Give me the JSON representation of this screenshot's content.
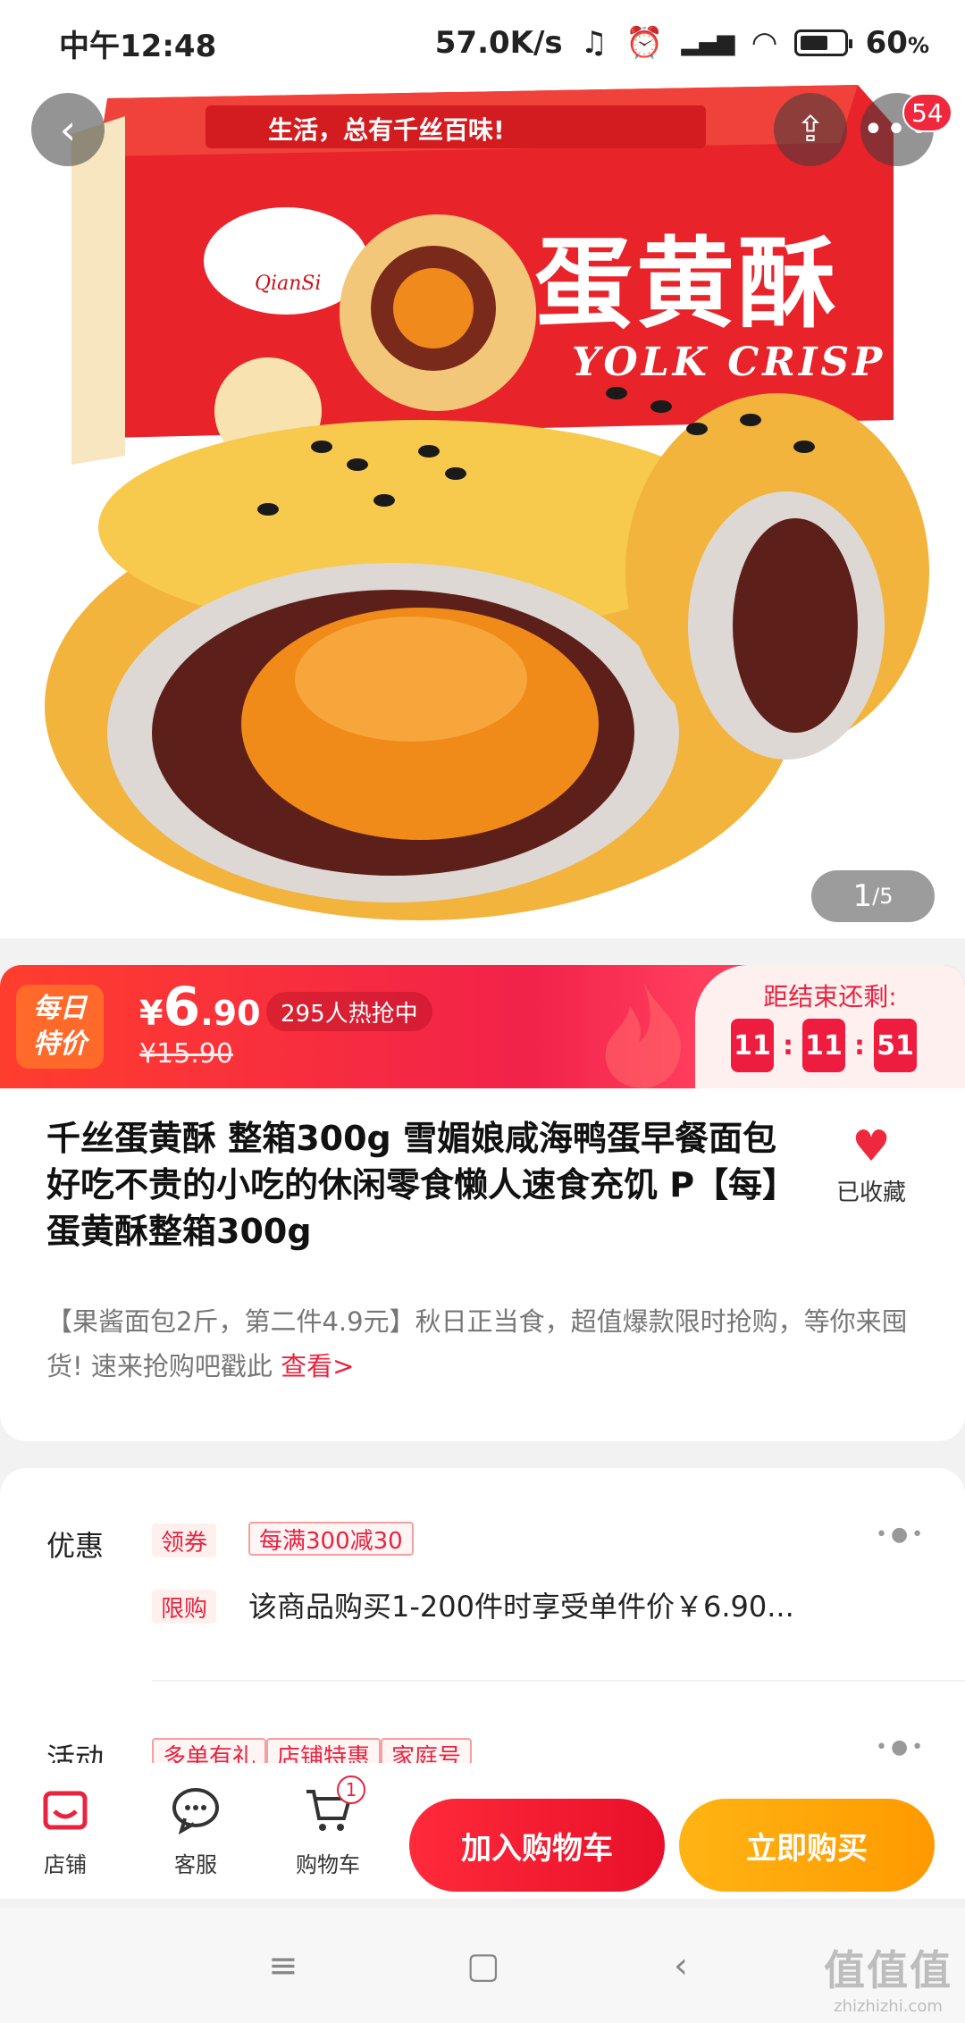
{
  "status_bar": {
    "time": "中午12:48",
    "network_speed": "57.0K/s",
    "battery": "60",
    "battery_unit": "%"
  },
  "header": {
    "cart_badge_count": "54"
  },
  "product_image": {
    "brand_en": "QianSi",
    "box_title": "蛋黄酥",
    "box_subtitle": "YOLK CRISP",
    "box_slogan": "生活，总有千丝百味!",
    "page_current": "1",
    "page_total": "/5"
  },
  "promo": {
    "tag_line1": "每日",
    "tag_line2": "特价",
    "currency": "¥",
    "price_int": "6",
    "price_dec": ".90",
    "price_old": "¥15.90",
    "hot_text": "295人热抢中",
    "countdown_label": "距结束还剩:",
    "countdown": [
      "11",
      "11",
      "51"
    ]
  },
  "product": {
    "title": "千丝蛋黄酥 整箱300g 雪媚娘咸海鸭蛋早餐面包好吃不贵的小吃的休闲零食懒人速食充饥 P【每】蛋黄酥整箱300g",
    "favorite_label": "已收藏",
    "description": "【果酱面包2斤，第二件4.9元】秋日正当食，超值爆款限时抢购，等你来囤货! 速来抢购吧戳此 ",
    "description_link": "查看>"
  },
  "offers": {
    "discount_label": "优惠",
    "coupon_tag": "领券",
    "coupon_value": "每满300减30",
    "limit_tag": "限购",
    "limit_text": "该商品购买1-200件时享受单件价￥6.90...",
    "activity_label": "活动",
    "activity_tags": [
      "多单有礼",
      "店铺特惠",
      "家庭号"
    ]
  },
  "action_bar": {
    "shop_label": "店铺",
    "service_label": "客服",
    "cart_label": "购物车",
    "cart_count": "1",
    "add_to_cart": "加入购物车",
    "buy_now": "立即购买"
  },
  "watermark": {
    "main": "值值值",
    "sub": "zhizhizhi.com"
  },
  "colors": {
    "accent_red": "#e8233f",
    "buy_orange": "#ff9a00"
  }
}
